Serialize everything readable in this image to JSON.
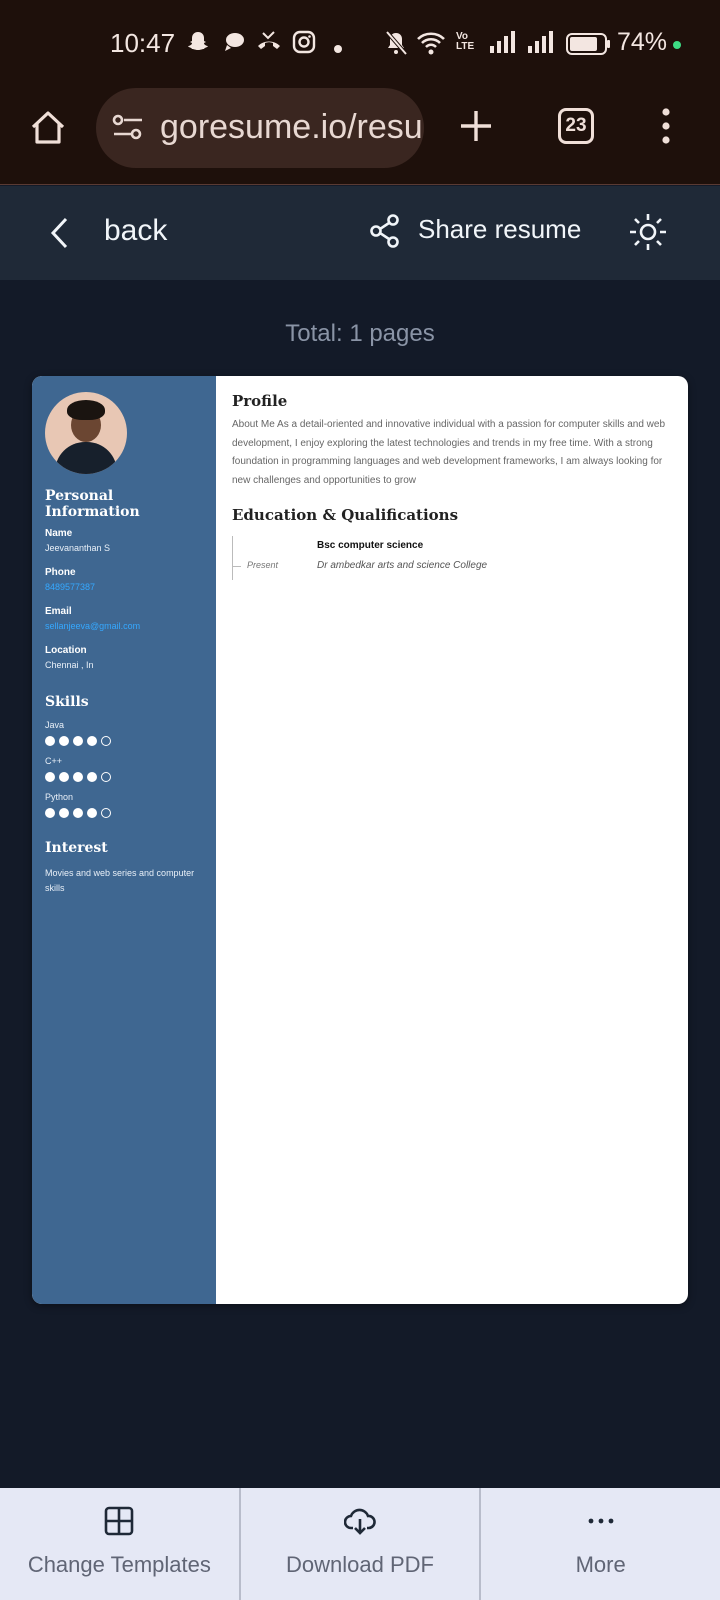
{
  "status_bar": {
    "time": "10:47",
    "battery": "74%"
  },
  "browser": {
    "url": "goresume.io/resu",
    "tab_count": "23"
  },
  "header": {
    "back_label": "back",
    "share_label": "Share resume"
  },
  "total_pages": "Total: 1 pages",
  "resume": {
    "sidebar": {
      "personal_heading": "Personal Information",
      "name_label": "Name",
      "name_value": "Jeevananthan S",
      "phone_label": "Phone",
      "phone_value": "8489577387",
      "email_label": "Email",
      "email_value": "sellanjeeva@gmail.com",
      "location_label": "Location",
      "location_value": "Chennai , In",
      "skills_heading": "Skills",
      "skills": [
        {
          "name": "Java",
          "level": 4,
          "max": 5
        },
        {
          "name": "C++",
          "level": 4,
          "max": 5
        },
        {
          "name": "Python",
          "level": 4,
          "max": 5
        }
      ],
      "interest_heading": "Interest",
      "interest_value": "Movies and web series and computer skills"
    },
    "main": {
      "profile_heading": "Profile",
      "profile_text": "About Me As a detail-oriented and innovative individual with a passion for computer skills and web development, I enjoy exploring the latest technologies and trends in my free time. With a strong foundation in programming languages and web development frameworks, I am always looking for new challenges and opportunities to grow",
      "education_heading": "Education & Qualifications",
      "education": [
        {
          "date": "Present",
          "degree": "Bsc computer science",
          "school": "Dr ambedkar arts and science College"
        }
      ]
    }
  },
  "bottom_bar": {
    "change_templates": "Change Templates",
    "download_pdf": "Download PDF",
    "more": "More"
  },
  "colors": {
    "sidebar": "#3f6791",
    "header": "#1f2937",
    "page_bg": "#131a28",
    "link": "#35a8ff"
  }
}
